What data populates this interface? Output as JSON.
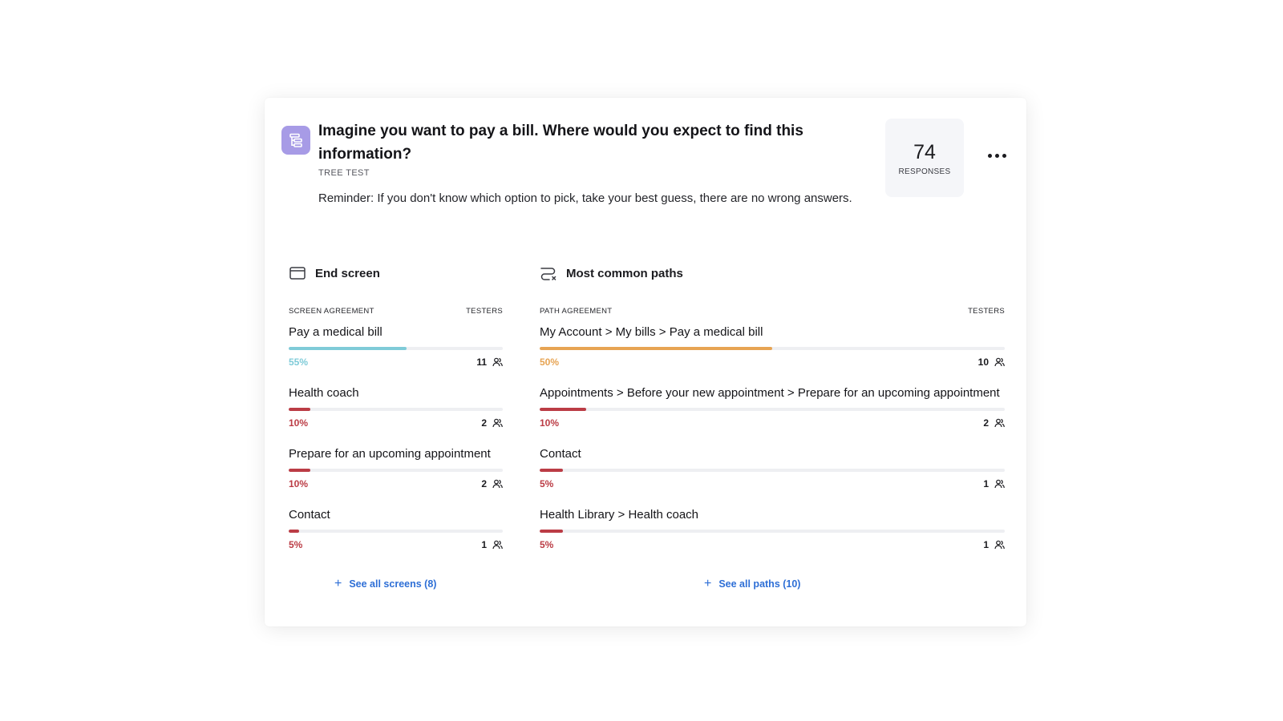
{
  "question": {
    "icon": "tree-test-icon",
    "title": "Imagine you want to pay a bill. Where would you expect to find this information?",
    "type": "TREE TEST",
    "description": "Reminder: If you don't know which option to pick, take your best guess, there are no wrong answers."
  },
  "responses": {
    "count": "74",
    "label": "RESPONSES"
  },
  "colors": {
    "success": "#7fcbd8",
    "path_success": "#e7a453",
    "fail": "#bb3c45",
    "link": "#2e6fd6",
    "icon_bg": "#a79be6"
  },
  "end_screen": {
    "title": "End screen",
    "icon": "screen-icon",
    "col_left": "SCREEN AGREEMENT",
    "col_right": "TESTERS",
    "rows": [
      {
        "label": "Pay a medical bill",
        "percent": "55%",
        "value": 0.55,
        "testers": "11",
        "status": "success"
      },
      {
        "label": "Health coach",
        "percent": "10%",
        "value": 0.1,
        "testers": "2",
        "status": "fail"
      },
      {
        "label": "Prepare for an upcoming appointment",
        "percent": "10%",
        "value": 0.1,
        "testers": "2",
        "status": "fail"
      },
      {
        "label": "Contact",
        "percent": "5%",
        "value": 0.05,
        "testers": "1",
        "status": "fail"
      }
    ],
    "see_all": "See all screens (8)"
  },
  "paths": {
    "title": "Most common paths",
    "icon": "path-icon",
    "col_left": "PATH AGREEMENT",
    "col_right": "TESTERS",
    "rows": [
      {
        "label": "My Account > My bills > Pay a medical bill",
        "percent": "50%",
        "value": 0.5,
        "testers": "10",
        "status": "path_success"
      },
      {
        "label": "Appointments > Before your new appointment > Prepare for an upcoming appointment",
        "percent": "10%",
        "value": 0.1,
        "testers": "2",
        "status": "fail"
      },
      {
        "label": "Contact",
        "percent": "5%",
        "value": 0.05,
        "testers": "1",
        "status": "fail"
      },
      {
        "label": "Health Library > Health coach",
        "percent": "5%",
        "value": 0.05,
        "testers": "1",
        "status": "fail"
      }
    ],
    "see_all": "See all paths (10)"
  }
}
